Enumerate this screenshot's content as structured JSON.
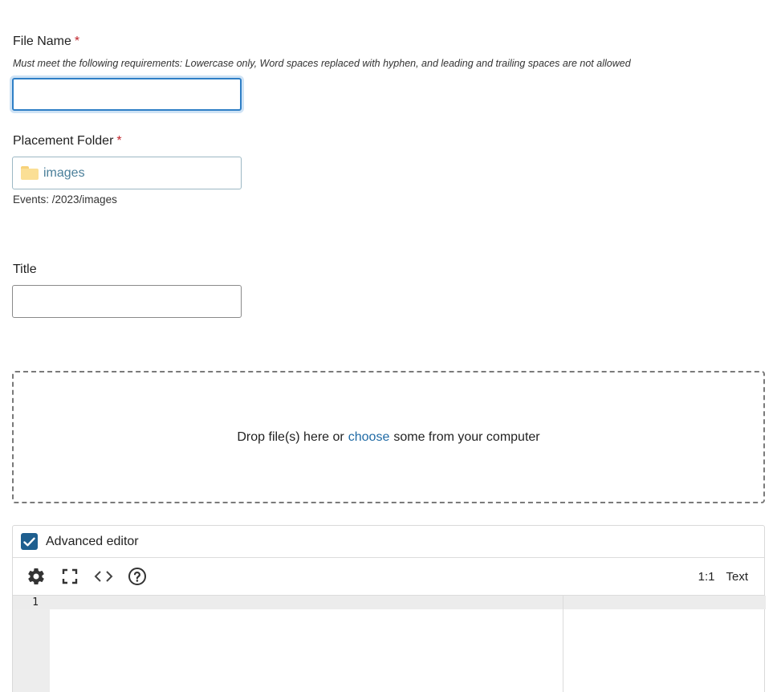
{
  "file_name": {
    "label": "File Name",
    "required_mark": "*",
    "hint": "Must meet the following requirements: Lowercase only, Word spaces replaced with hyphen, and leading and trailing spaces are not allowed",
    "value": ""
  },
  "placement_folder": {
    "label": "Placement Folder",
    "required_mark": "*",
    "value": "images",
    "path": "Events: /2023/images",
    "folder_color": "#fbdf95"
  },
  "title_field": {
    "label": "Title",
    "value": ""
  },
  "dropzone": {
    "prefix": "Drop file(s) here or",
    "link": "choose",
    "suffix": "some from your computer"
  },
  "editor": {
    "advanced_label": "Advanced editor",
    "advanced_checked": true,
    "toolbar_icons": [
      "gear-icon",
      "fullscreen-icon",
      "code-icon",
      "help-icon"
    ],
    "cursor_position": "1:1",
    "mode": "Text",
    "line_numbers": [
      "1"
    ]
  },
  "colors": {
    "accent": "#1f5f8f",
    "link": "#1f6aa5",
    "required": "#c0262d",
    "focus": "#2f7fc6"
  }
}
